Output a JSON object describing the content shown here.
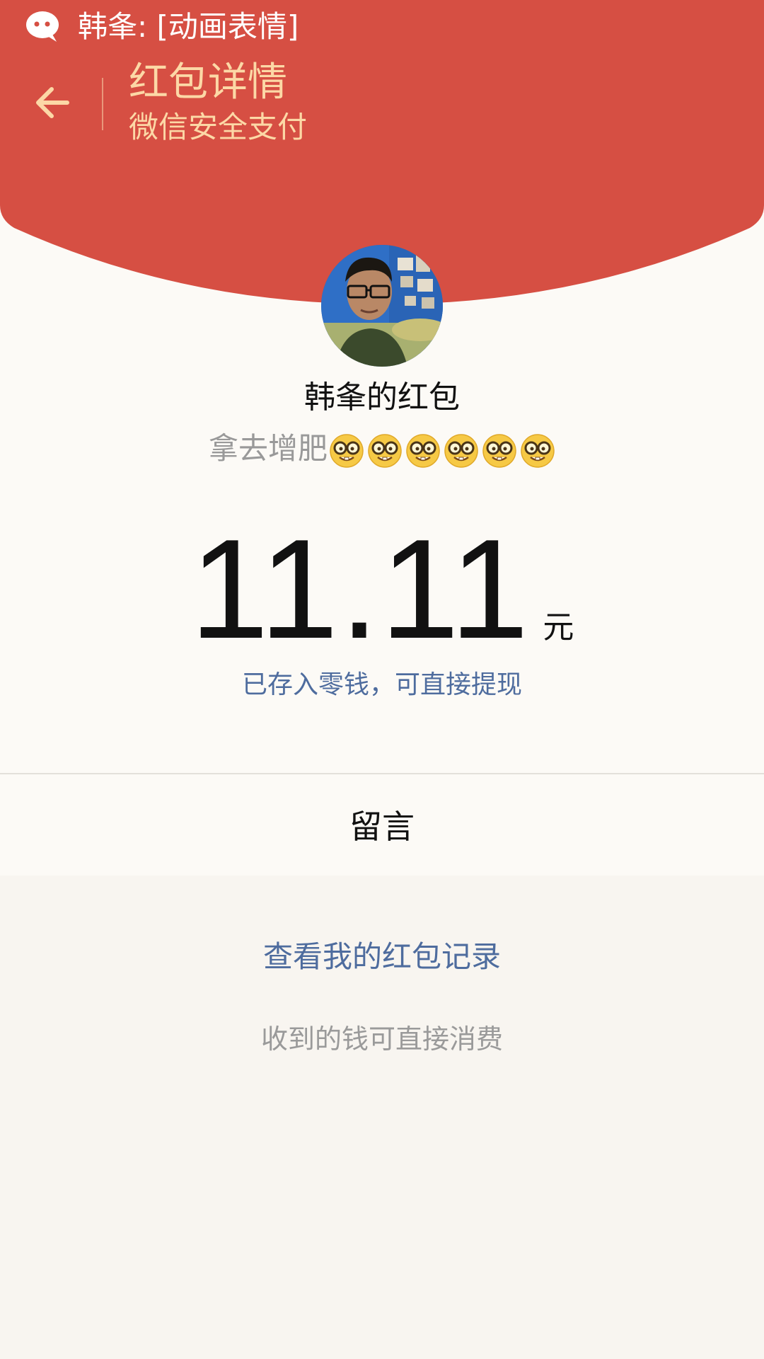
{
  "notification": {
    "text": "韩夆: [动画表情]",
    "icon": "wechat-bubble-icon"
  },
  "header": {
    "title": "红包详情",
    "subtitle": "微信安全支付",
    "back_icon": "back-arrow-icon"
  },
  "envelope": {
    "sender_title": "韩夆的红包",
    "blessing_text": "拿去增肥",
    "blessing_emoji_name": "nerd-face-emoji",
    "blessing_emoji_count": 6,
    "amount": "11.11",
    "unit": "元",
    "stored_note": "已存入零钱，可直接提现"
  },
  "actions": {
    "message_label": "留言",
    "records_link": "查看我的红包记录",
    "spend_note": "收到的钱可直接消费"
  },
  "colors": {
    "header_red": "#d64f43",
    "title_gold": "#fcd8a6",
    "link_blue": "#4e6c9e",
    "page_cream": "#fcfaf6",
    "page_bottom": "#f8f5f0"
  }
}
